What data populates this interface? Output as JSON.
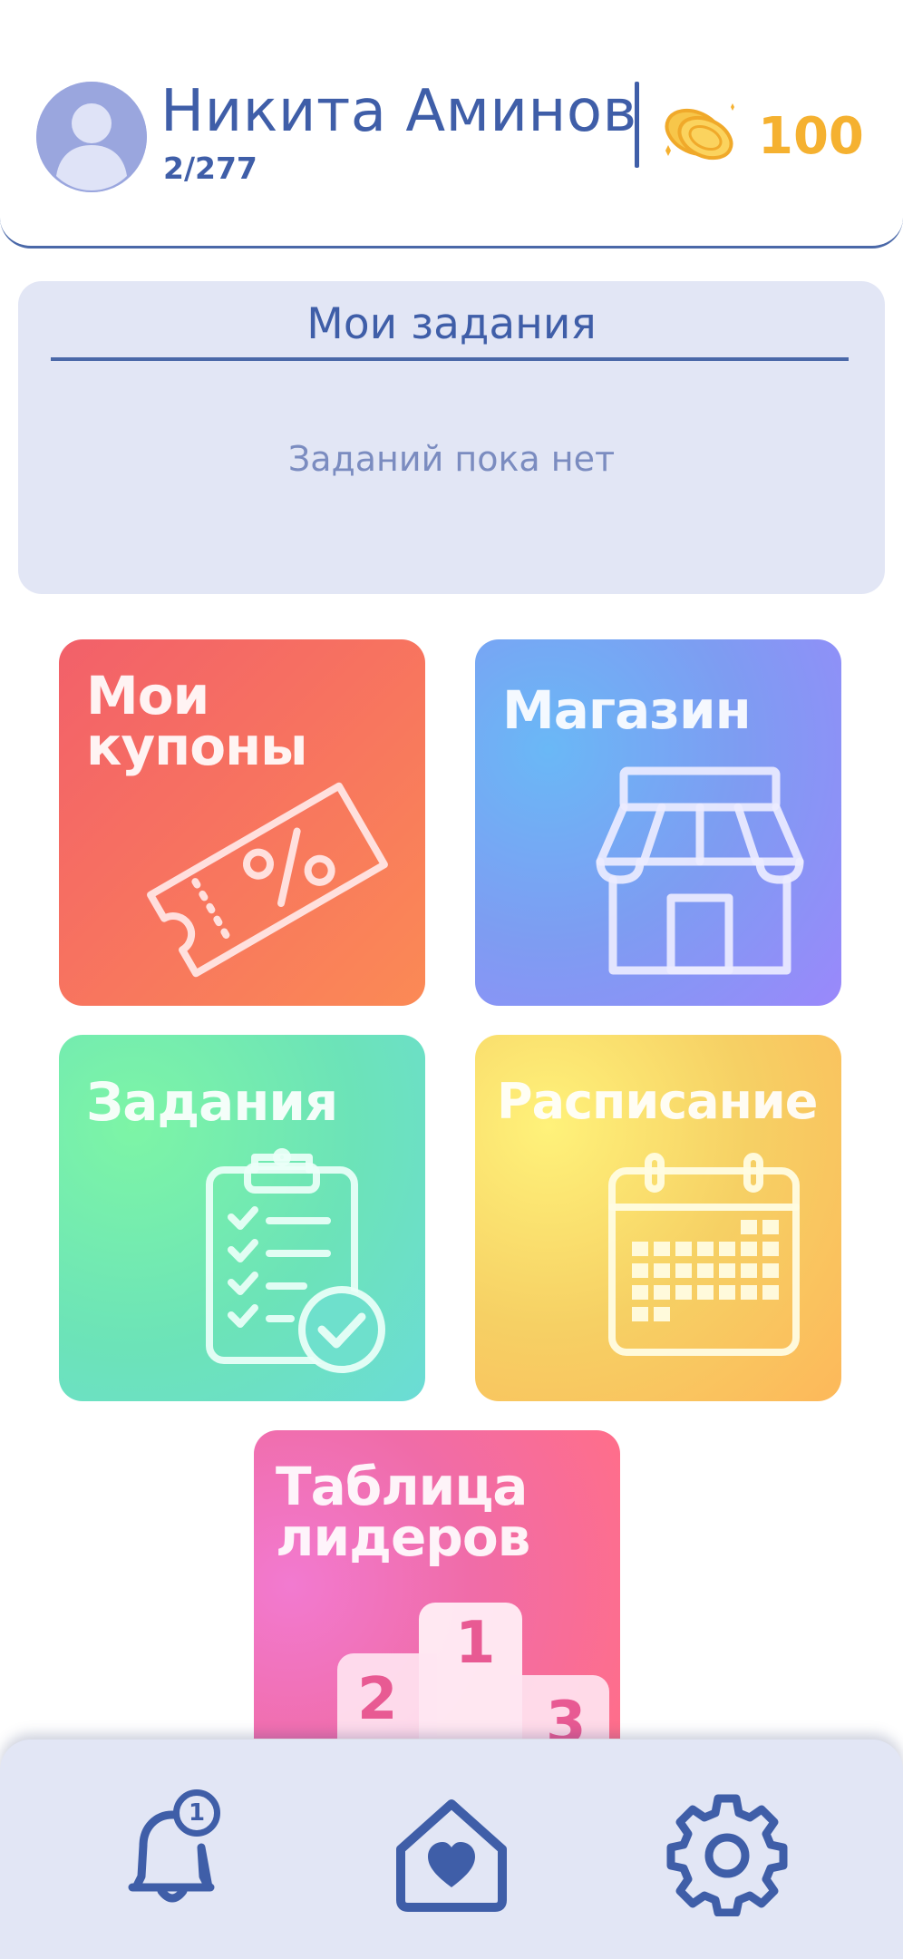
{
  "header": {
    "user_name": "Никита Аминов",
    "rank": "2/277",
    "coins": "100",
    "avatar_icon": "user-avatar-icon",
    "coin_icon": "coins-icon"
  },
  "tasks_panel": {
    "title": "Мои задания",
    "empty_text": "Заданий пока нет"
  },
  "tiles": {
    "coupons": {
      "label_line1": "Мои",
      "label_line2": "купоны",
      "icon": "coupon-percent-icon"
    },
    "shop": {
      "label": "Магазин",
      "icon": "storefront-icon"
    },
    "tasks": {
      "label": "Задания",
      "icon": "clipboard-checklist-icon"
    },
    "schedule": {
      "label": "Расписание",
      "icon": "calendar-icon"
    },
    "leaders": {
      "label_line1": "Таблица",
      "label_line2": "лидеров",
      "icon": "podium-icon",
      "podium": [
        "1",
        "2",
        "3"
      ]
    }
  },
  "bottom_nav": {
    "items": [
      {
        "name": "notifications",
        "icon": "bell-icon",
        "badge": "1"
      },
      {
        "name": "home",
        "icon": "home-heart-icon"
      },
      {
        "name": "settings",
        "icon": "gear-icon"
      }
    ]
  },
  "colors": {
    "primary": "#3f5ea8",
    "panel_bg": "#e2e6f5",
    "coin": "#f5b130"
  }
}
